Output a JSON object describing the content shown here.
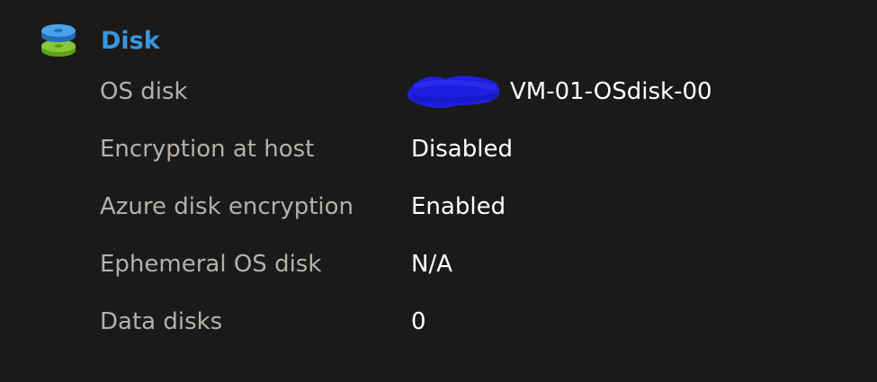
{
  "section": {
    "title": "Disk",
    "icon": "disk-icon"
  },
  "properties": [
    {
      "label": "OS disk",
      "value": "VM-01-OSdisk-00"
    },
    {
      "label": "Encryption at host",
      "value": "Disabled"
    },
    {
      "label": "Azure disk encryption",
      "value": "Enabled"
    },
    {
      "label": "Ephemeral OS disk",
      "value": "N/A"
    },
    {
      "label": "Data disks",
      "value": "0"
    }
  ],
  "colors": {
    "background": "#1b1a19",
    "title": "#3a96dd",
    "label": "#b3b0ad",
    "value": "#ffffff",
    "redaction": "#1f1fe0"
  }
}
